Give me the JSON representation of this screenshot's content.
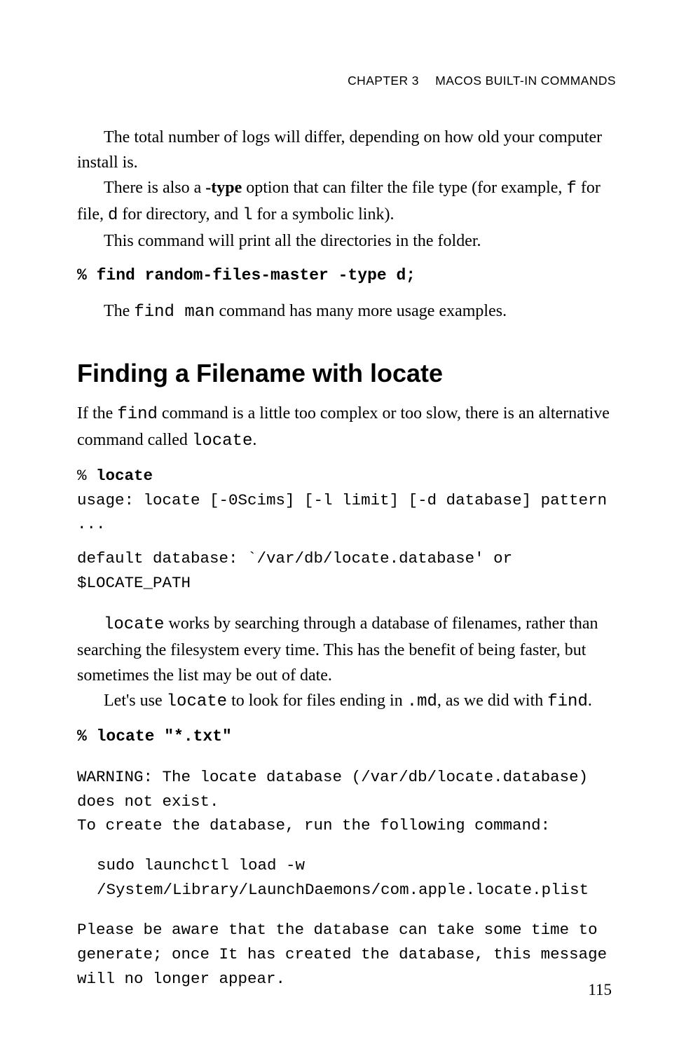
{
  "header": {
    "chapter": "CHAPTER 3",
    "title": "MACOS BUILT-IN COMMANDS"
  },
  "p1a": "The total number of logs will differ, depending on how old your computer install is.",
  "p2a": "There is also a ",
  "p2b": "-type",
  "p2c": " option that can filter the file type (for example, ",
  "p2d": "f",
  "p2e": " for file, ",
  "p2f": "d",
  "p2g": " for directory, and ",
  "p2h": "l",
  "p2i": " for a symbolic link).",
  "p3": "This command will print all the directories in the folder.",
  "code1": "% find random-files-master -type d;",
  "p4a": "The ",
  "p4b": "find man",
  "p4c": " command has many more usage examples.",
  "h2": "Finding a Filename with locate",
  "p5a": "If the ",
  "p5b": "find",
  "p5c": " command is a little too complex or too slow, there is an alternative command called ",
  "p5d": "locate",
  "p5e": ".",
  "code2a": "% ",
  "code2b": "locate",
  "code3": "usage: locate [-0Scims] [-l limit] [-d database] pattern ...",
  "code4": "default database: `/var/db/locate.database' or $LOCATE_PATH",
  "p6a": "locate",
  "p6b": " works by searching through a database of filenames, rather than searching the filesystem every time. This has the benefit of being faster, but sometimes the list may be out of date.",
  "p7a": "Let's use ",
  "p7b": "locate",
  "p7c": " to look for files ending in ",
  "p7d": ".md",
  "p7e": ", as we did with ",
  "p7f": "find",
  "p7g": ".",
  "code5": "% locate \"*.txt\"",
  "code6": "WARNING: The locate database (/var/db/locate.database) does not exist.",
  "code7": "To create the database, run the following command:",
  "code8": "sudo launchctl load -w /System/Library/LaunchDaemons/com.apple.locate.plist",
  "code9": "Please be aware that the database can take some time to generate; once It has created the database, this message will no longer appear.",
  "pagenum": "115"
}
